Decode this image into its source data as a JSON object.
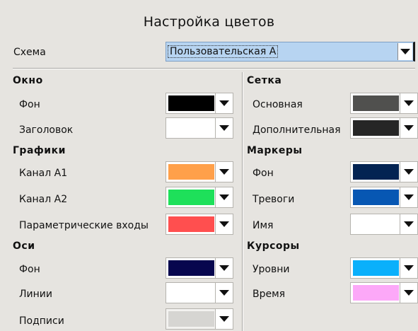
{
  "title": "Настройка цветов",
  "scheme": {
    "label": "Схема",
    "value": "Пользовательская А"
  },
  "left": {
    "window": {
      "title": "Окно",
      "items": [
        {
          "label": "Фон",
          "color": "#000000"
        },
        {
          "label": "Заголовок",
          "color": "#ffffff"
        }
      ]
    },
    "graphics": {
      "title": "Графики",
      "items": [
        {
          "label": "Канал A1",
          "color": "#ffa04a"
        },
        {
          "label": "Канал A2",
          "color": "#1ee05a"
        },
        {
          "label": "Параметрические входы",
          "color": "#ff4f4f"
        }
      ]
    },
    "axes": {
      "title": "Оси",
      "items": [
        {
          "label": "Фон",
          "color": "#07064e"
        },
        {
          "label": "Линии",
          "color": "#ffffff"
        },
        {
          "label": "Подписи",
          "color": "#d6d5d2"
        }
      ]
    }
  },
  "right": {
    "grid": {
      "title": "Сетка",
      "items": [
        {
          "label": "Основная",
          "color": "#50504e"
        },
        {
          "label": "Дополнительная",
          "color": "#262626"
        }
      ]
    },
    "markers": {
      "title": "Маркеры",
      "items": [
        {
          "label": "Фон",
          "color": "#032352"
        },
        {
          "label": "Тревоги",
          "color": "#0757b3"
        },
        {
          "label": "Имя",
          "color": "#ffffff"
        }
      ]
    },
    "cursors": {
      "title": "Курсоры",
      "items": [
        {
          "label": "Уровни",
          "color": "#0ab0fb"
        },
        {
          "label": "Время",
          "color": "#fca8f8"
        }
      ]
    }
  }
}
